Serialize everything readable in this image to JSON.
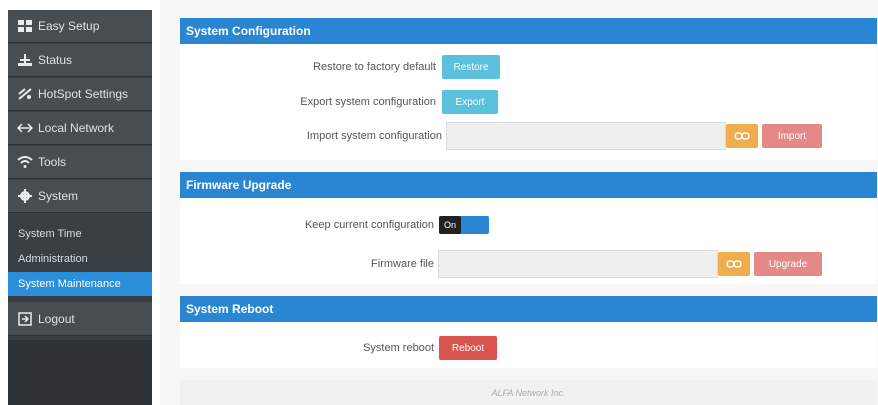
{
  "sidebar": {
    "items": [
      {
        "label": "Easy Setup",
        "icon": "grid-icon"
      },
      {
        "label": "Status",
        "icon": "scale-icon"
      },
      {
        "label": "HotSpot Settings",
        "icon": "hotspot-icon"
      },
      {
        "label": "Local Network",
        "icon": "arrows-icon"
      },
      {
        "label": "Tools",
        "icon": "wifi-icon"
      },
      {
        "label": "System",
        "icon": "gear-icon"
      }
    ],
    "sub_items": [
      {
        "label": "System Time"
      },
      {
        "label": "Administration"
      },
      {
        "label": "System Maintenance",
        "active": true
      }
    ],
    "logout": {
      "label": "Logout",
      "icon": "logout-icon"
    }
  },
  "panels": {
    "config": {
      "title": "System Configuration",
      "restore_label": "Restore to factory default",
      "restore_button": "Restore",
      "export_label": "Export system configuration",
      "export_button": "Export",
      "import_label": "Import system configuration",
      "import_button": "Import"
    },
    "firmware": {
      "title": "Firmware Upgrade",
      "keep_label": "Keep current configuration",
      "keep_toggle": "On",
      "file_label": "Firmware file",
      "upgrade_button": "Upgrade"
    },
    "reboot": {
      "title": "System Reboot",
      "reboot_label": "System reboot",
      "reboot_button": "Reboot"
    }
  },
  "footer": {
    "text": "ALFA Network Inc."
  },
  "colors": {
    "accent": "#2a86d3",
    "sidebar": "#3a3f44",
    "info": "#5bc0de",
    "warning": "#f0ad4e",
    "danger": "#d9534f"
  }
}
